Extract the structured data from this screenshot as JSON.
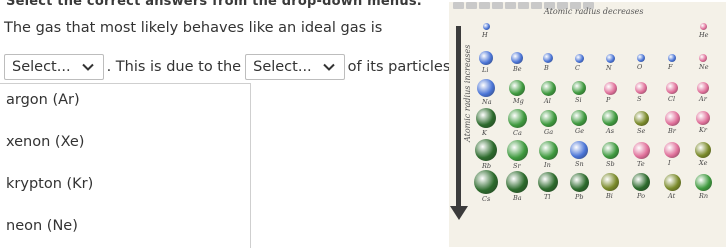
{
  "header": {
    "title": "Select the correct answers from the drop-down menus."
  },
  "question": {
    "prompt": "The gas that most likely behaves like an ideal gas is",
    "dropdown1": {
      "value": "Select..."
    },
    "middle_text": ". This is due to the",
    "dropdown2": {
      "value": "Select..."
    },
    "end_text": "of its particles."
  },
  "options": [
    {
      "label": "argon (Ar)"
    },
    {
      "label": "xenon (Xe)"
    },
    {
      "label": "krypton (Kr)"
    },
    {
      "label": "neon (Ne)"
    }
  ],
  "periodic_table": {
    "horizontal_label": "Atomic radius decreases",
    "vertical_label": "Atomic radius increases",
    "elements": [
      "H",
      "He",
      "Li",
      "Be",
      "B",
      "C",
      "N",
      "O",
      "F",
      "Ne",
      "Na",
      "Mg",
      "Al",
      "Si",
      "P",
      "S",
      "Cl",
      "Ar",
      "K",
      "Ca",
      "Ga",
      "Ge",
      "As",
      "Se",
      "Br",
      "Kr",
      "Rb",
      "Sr",
      "In",
      "Sn",
      "Sb",
      "Te",
      "I",
      "Xe",
      "Cs",
      "Ba",
      "Tl",
      "Pb",
      "Bi",
      "Po",
      "At",
      "Rn"
    ],
    "colors": {
      "blue": "#4a74d6",
      "green": "#3f9a3f",
      "pink": "#e0709a",
      "dark_green": "#2d6b2d",
      "olive": "#7a8a2a",
      "arrow": "#3b3b3b"
    }
  }
}
